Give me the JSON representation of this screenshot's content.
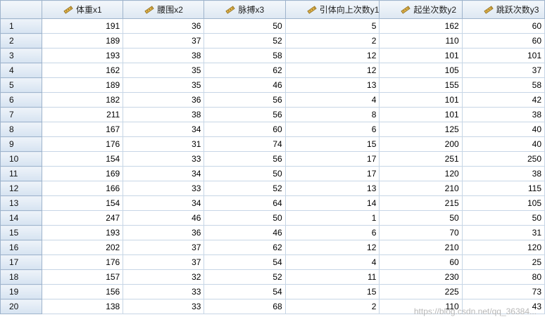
{
  "columns": [
    "体重x1",
    "腰围x2",
    "脉搏x3",
    "引体向上次数y1",
    "起坐次数y2",
    "跳跃次数y3"
  ],
  "rows": [
    [
      1,
      191,
      36,
      50,
      5,
      162,
      60
    ],
    [
      2,
      189,
      37,
      52,
      2,
      110,
      60
    ],
    [
      3,
      193,
      38,
      58,
      12,
      101,
      101
    ],
    [
      4,
      162,
      35,
      62,
      12,
      105,
      37
    ],
    [
      5,
      189,
      35,
      46,
      13,
      155,
      58
    ],
    [
      6,
      182,
      36,
      56,
      4,
      101,
      42
    ],
    [
      7,
      211,
      38,
      56,
      8,
      101,
      38
    ],
    [
      8,
      167,
      34,
      60,
      6,
      125,
      40
    ],
    [
      9,
      176,
      31,
      74,
      15,
      200,
      40
    ],
    [
      10,
      154,
      33,
      56,
      17,
      251,
      250
    ],
    [
      11,
      169,
      34,
      50,
      17,
      120,
      38
    ],
    [
      12,
      166,
      33,
      52,
      13,
      210,
      115
    ],
    [
      13,
      154,
      34,
      64,
      14,
      215,
      105
    ],
    [
      14,
      247,
      46,
      50,
      1,
      50,
      50
    ],
    [
      15,
      193,
      36,
      46,
      6,
      70,
      31
    ],
    [
      16,
      202,
      37,
      62,
      12,
      210,
      120
    ],
    [
      17,
      176,
      37,
      54,
      4,
      60,
      25
    ],
    [
      18,
      157,
      32,
      52,
      11,
      230,
      80
    ],
    [
      19,
      156,
      33,
      54,
      15,
      225,
      73
    ],
    [
      20,
      138,
      33,
      68,
      2,
      110,
      43
    ]
  ],
  "header_icon": "ruler-icon",
  "watermark": "https://blog.csdn.net/qq_36384...",
  "colors": {
    "header_bg": "#dde7f2",
    "grid_line": "#c7d6e6"
  }
}
